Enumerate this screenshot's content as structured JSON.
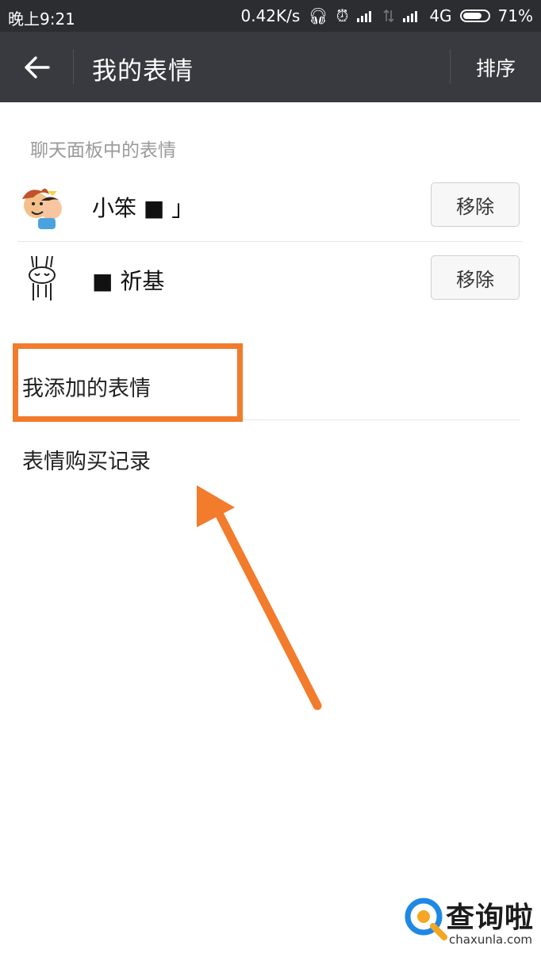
{
  "status_bar": {
    "time": "晚上9:21",
    "speed": "0.42K/s",
    "network": "4G",
    "battery": "71%"
  },
  "header": {
    "title": "我的表情",
    "sort_label": "排序"
  },
  "chat_panel": {
    "header": "聊天面板中的表情",
    "items": [
      {
        "name": "小笨 ■ 」",
        "remove_label": "移除"
      },
      {
        "name": "■ 祈基",
        "remove_label": "移除"
      }
    ]
  },
  "menu": {
    "added": "我添加的表情",
    "purchases": "表情购买记录"
  },
  "annotation": {
    "color": "#f27b2c"
  },
  "watermark": {
    "name": "查询啦",
    "domain": "chaxunla.com"
  }
}
